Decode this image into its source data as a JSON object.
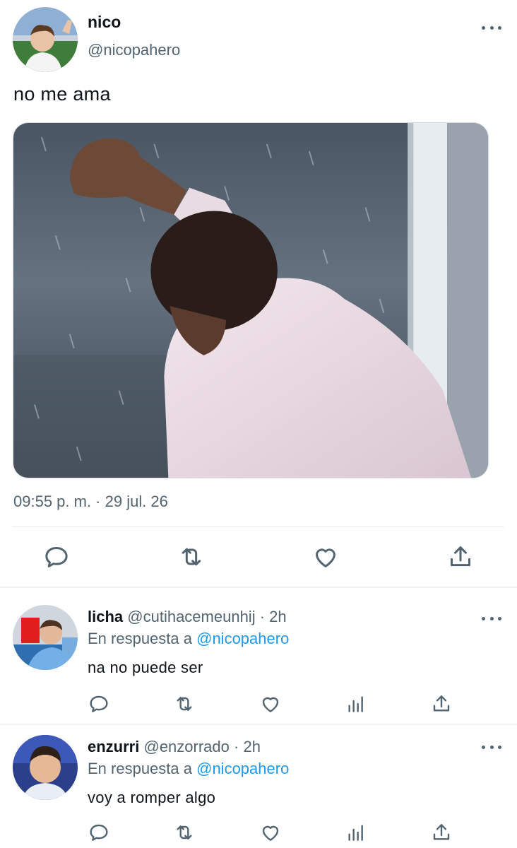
{
  "tweet": {
    "author_name": "nico",
    "author_handle": "@nicopahero",
    "text": "no me ama",
    "timestamp": "09:55 p. m. · 29 jul. 26",
    "media_icon": "meme-photo-rain-window",
    "actions": [
      "reply-icon",
      "retweet-icon",
      "like-icon",
      "share-icon"
    ]
  },
  "replies": [
    {
      "name": "licha",
      "handle": "@cutihacemeunhij",
      "time": "· 2h",
      "reply_prefix": "En respuesta a",
      "reply_mention": "@nicopahero",
      "text": "na no puede ser"
    },
    {
      "name": "enzurri",
      "handle": "@enzorrado",
      "time": "· 2h",
      "reply_prefix": "En respuesta a",
      "reply_mention": "@nicopahero",
      "text": "voy a romper algo"
    }
  ],
  "colors": {
    "text": "#0f1419",
    "secondary": "#536471",
    "link": "#1d9bf0",
    "divider": "#eff1f2"
  }
}
